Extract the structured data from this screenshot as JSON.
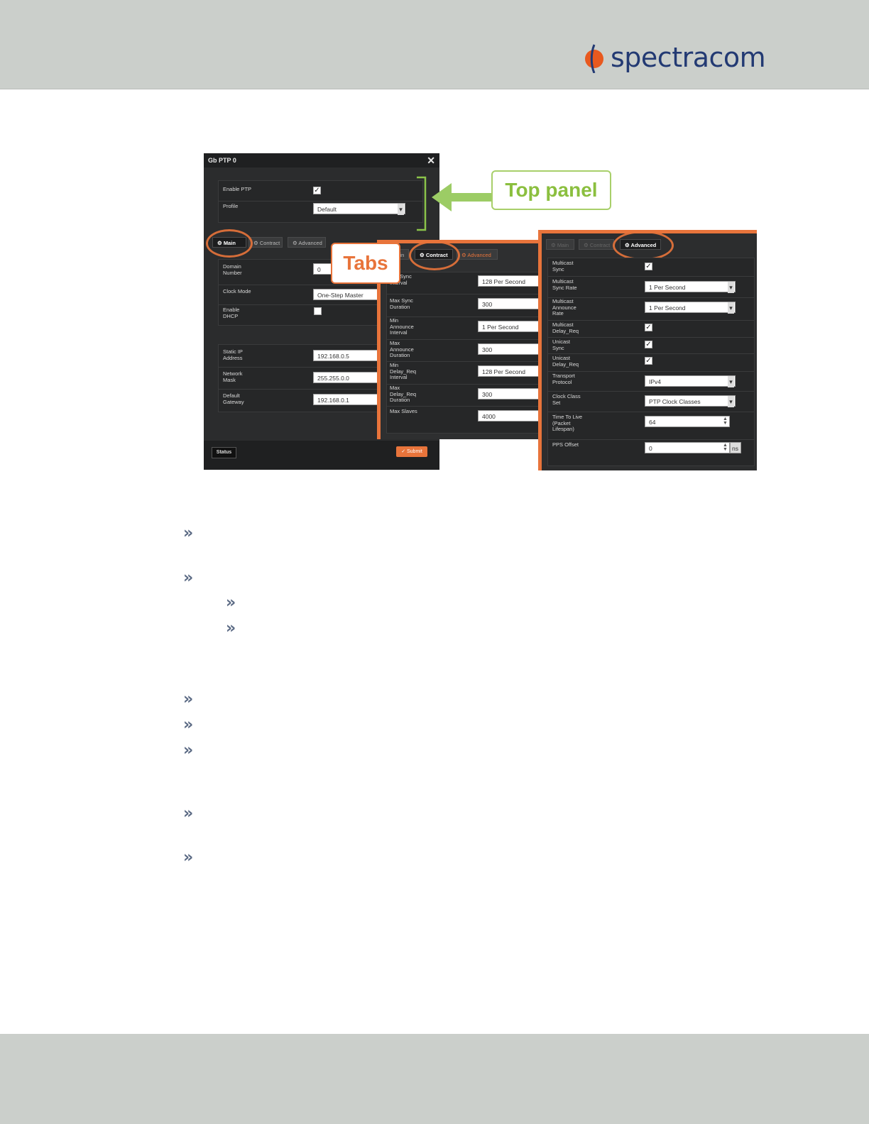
{
  "brand": {
    "name": "spectracom",
    "accent": "#e8743b",
    "navy": "#233a73"
  },
  "dialog": {
    "title": "Gb PTP 0",
    "top_panel": {
      "enable_ptp_label": "Enable PTP",
      "enable_ptp_checked": true,
      "profile_label": "Profile",
      "profile_value": "Default"
    },
    "tabs": {
      "main": "Main",
      "contract": "Contract",
      "advanced": "Advanced"
    },
    "main": {
      "domain_number_label": "Domain Number",
      "domain_number_value": "0",
      "clock_mode_label": "Clock Mode",
      "clock_mode_value": "One-Step Master",
      "enable_dhcp_label": "Enable DHCP",
      "static_ip_label": "Static IP Address",
      "static_ip_value": "192.168.0.5",
      "network_mask_label": "Network Mask",
      "network_mask_value": "255.255.0.0",
      "default_gateway_label": "Default Gateway",
      "default_gateway_value": "192.168.0.1"
    },
    "contract": {
      "min_sync_interval_label": "Min Sync Interval",
      "min_sync_interval_value": "128 Per Second",
      "max_sync_duration_label": "Max Sync Duration",
      "max_sync_duration_value": "300",
      "min_announce_interval_label": "Min Announce Interval",
      "min_announce_interval_value": "1 Per Second",
      "max_announce_duration_label": "Max Announce Duration",
      "max_announce_duration_value": "300",
      "min_delay_req_interval_label": "Min Delay_Req Interval",
      "min_delay_req_interval_value": "128 Per Second",
      "max_delay_req_duration_label": "Max Delay_Req Duration",
      "max_delay_req_duration_value": "300",
      "max_slaves_label": "Max Slaves",
      "max_slaves_value": "4000"
    },
    "advanced": {
      "multicast_sync_label": "Multicast Sync",
      "multicast_sync_rate_label": "Multicast Sync Rate",
      "multicast_sync_rate_value": "1 Per Second",
      "multicast_announce_rate_label": "Multicast Announce Rate",
      "multicast_announce_rate_value": "1 Per Second",
      "multicast_delay_req_label": "Multicast Delay_Req",
      "unicast_sync_label": "Unicast Sync",
      "unicast_delay_req_label": "Unicast Delay_Req",
      "transport_protocol_label": "Transport Protocol",
      "transport_protocol_value": "IPv4",
      "clock_class_set_label": "Clock Class Set",
      "clock_class_set_value": "PTP Clock Classes",
      "ttl_label": "Time To Live (Packet Lifespan)",
      "ttl_value": "64",
      "pps_offset_label": "PPS Offset",
      "pps_offset_value": "0",
      "pps_offset_unit": "ns"
    },
    "buttons": {
      "status": "Status",
      "submit": "Submit"
    }
  },
  "callouts": {
    "top_panel": "Top panel",
    "tabs": "Tabs"
  },
  "bullet_glyph": "»"
}
